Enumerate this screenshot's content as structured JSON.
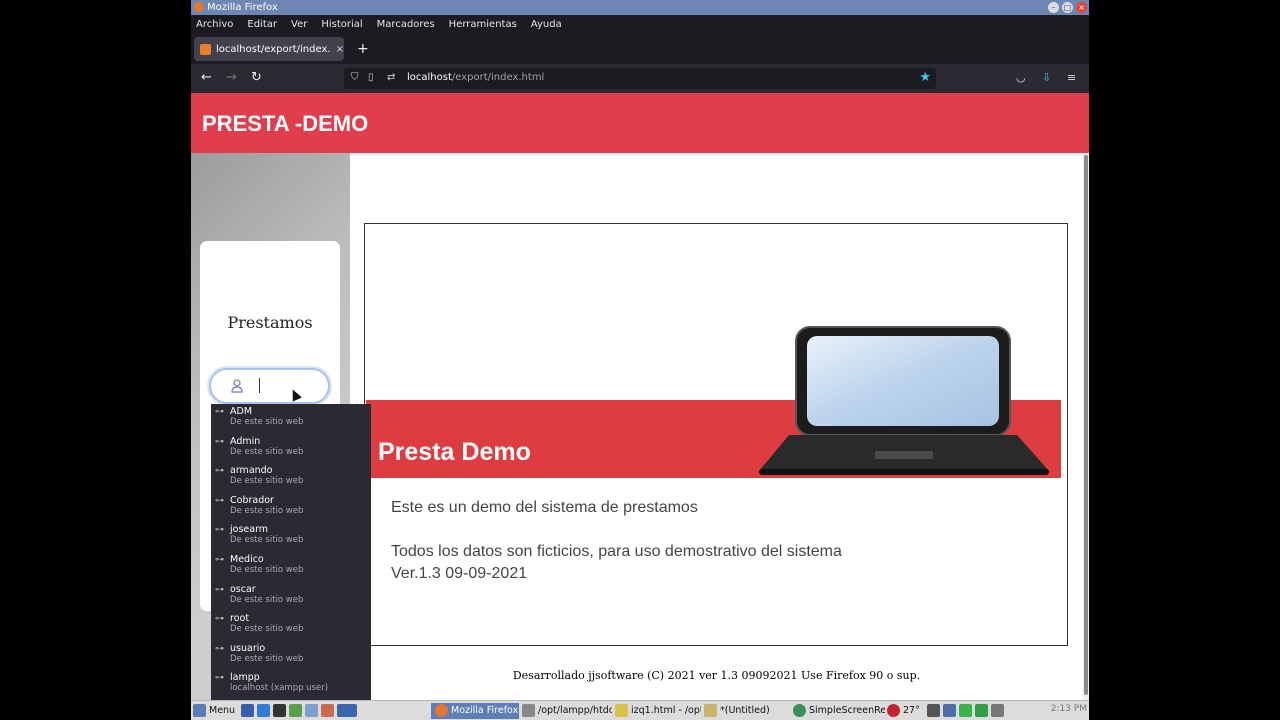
{
  "window": {
    "title": "Mozilla Firefox"
  },
  "menu": [
    "Archivo",
    "Editar",
    "Ver",
    "Historial",
    "Marcadores",
    "Herramientas",
    "Ayuda"
  ],
  "tab": {
    "title": "localhost/export/index.htm",
    "close": "×",
    "new": "+"
  },
  "nav": {
    "back": "←",
    "forward": "→",
    "reload": "↻",
    "url_host": "localhost",
    "url_path": "/export/index.html",
    "star": "★"
  },
  "page": {
    "brand": "PRESTA -DEMO",
    "sidebar_title": "Prestamos",
    "banner_title": "Presta Demo",
    "desc_line1": "Este es un demo del sistema de prestamos",
    "desc_line2": "Todos los datos son ficticios, para uso demostrativo del sistema",
    "desc_line3": "Ver.1.3 09-09-2021",
    "footer": "Desarrollado jjsoftware (C) 2021 ver 1.3 09092021 Use Firefox 90 o sup."
  },
  "autocomplete": [
    {
      "user": "ADM",
      "source": "De este sitio web"
    },
    {
      "user": "Admin",
      "source": "De este sitio web"
    },
    {
      "user": "armando",
      "source": "De este sitio web"
    },
    {
      "user": "Cobrador",
      "source": "De este sitio web"
    },
    {
      "user": "josearm",
      "source": "De este sitio web"
    },
    {
      "user": "Medico",
      "source": "De este sitio web"
    },
    {
      "user": "oscar",
      "source": "De este sitio web"
    },
    {
      "user": "root",
      "source": "De este sitio web"
    },
    {
      "user": "usuario",
      "source": "De este sitio web"
    },
    {
      "user": "lampp",
      "source": "localhost (xampp user)"
    }
  ],
  "taskbar": {
    "menu": "Menu",
    "items": [
      "Mozilla Firefox",
      "/opt/lampp/htdc",
      "izq1.html - /opt",
      "*(Untitled)",
      "SimpleScreenRe"
    ],
    "temp": "27°",
    "clock": "2:13 PM"
  },
  "colors": {
    "header": "#e03d4d",
    "banner": "#dd3d40",
    "titlebar": "#6d86b3",
    "chrome": "#2b2a33"
  }
}
